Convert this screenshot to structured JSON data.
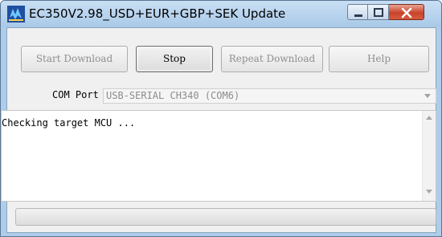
{
  "window": {
    "title": "EC350V2.98_USD+EUR+GBP+SEK Update",
    "icon": "app-logo-icon"
  },
  "toolbar": {
    "start_download_label": "Start Download",
    "stop_label": "Stop",
    "repeat_download_label": "Repeat Download",
    "help_label": "Help"
  },
  "com_port": {
    "label": "COM Port",
    "selected": "USB-SERIAL CH340 (COM6)"
  },
  "log": {
    "text": "Checking target MCU ..."
  },
  "progress": {
    "value": 0
  },
  "colors": {
    "close_button": "#c8442b",
    "titlebar": "#aecdea"
  }
}
